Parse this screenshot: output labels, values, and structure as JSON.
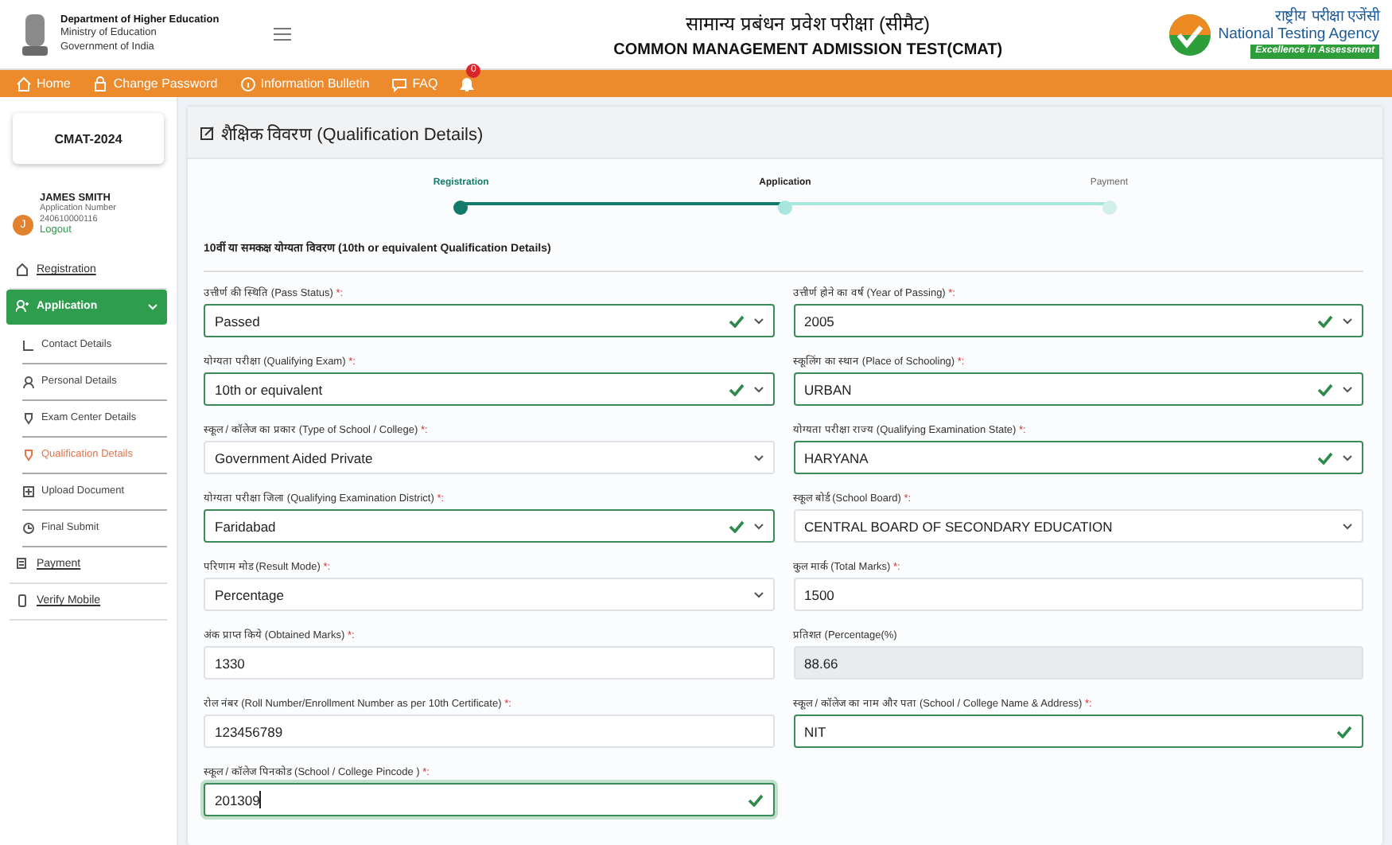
{
  "header": {
    "dept": "Department of Higher Education",
    "ministry": "Ministry of Education",
    "govt": "Government of India",
    "title_hi": "सामान्य प्रबंधन प्रवेश परीक्षा (सीमैट)",
    "title_en": "COMMON MANAGEMENT ADMISSION TEST(CMAT)",
    "agency_hi": "राष्ट्रीय परीक्षा एजेंसी",
    "agency_en": "National Testing Agency",
    "tagline": "Excellence in Assessment"
  },
  "nav": [
    {
      "label": "Home"
    },
    {
      "label": "Change Password"
    },
    {
      "label": "Information Bulletin"
    },
    {
      "label": "FAQ"
    }
  ],
  "notifications": {
    "count": "0"
  },
  "sidebar": {
    "exam": "CMAT-2024",
    "user": {
      "initial": "J",
      "name": "JAMES SMITH",
      "number_label": "Application Number",
      "number": "240610000116",
      "logout": "Logout"
    },
    "items": [
      {
        "label": "Registration",
        "selected": false
      },
      {
        "label": "Application",
        "selected": true,
        "expanded": true,
        "children": [
          {
            "label": "Contact Details",
            "selected": false
          },
          {
            "label": "Personal Details",
            "selected": false
          },
          {
            "label": "Exam Center Details",
            "selected": false
          },
          {
            "label": "Qualification Details",
            "selected": true
          },
          {
            "label": "Upload Document",
            "selected": false
          },
          {
            "label": "Final Submit",
            "selected": false
          }
        ]
      },
      {
        "label": "Payment",
        "selected": false
      },
      {
        "label": "Verify Mobile",
        "selected": false
      }
    ]
  },
  "page": {
    "title": "शैक्षिक विवरण (Qualification Details)"
  },
  "steps": [
    {
      "label": "Registration",
      "completed": true,
      "current": false
    },
    {
      "label": "Application",
      "completed": false,
      "current": true
    },
    {
      "label": "Payment",
      "completed": false,
      "current": false
    }
  ],
  "section": "10वीं या समकक्ष योग्यता विवरण (10th or equivalent Qualification Details)",
  "fields": [
    {
      "label": "उत्तीर्ण की स्थिति (Pass Status)",
      "mark": "*:",
      "value": "Passed",
      "kind": "select",
      "valid": true
    },
    {
      "label": "उत्तीर्ण होने का वर्ष (Year of Passing)",
      "mark": "*:",
      "value": "2005",
      "kind": "select",
      "valid": true
    },
    {
      "label": "योग्यता परीक्षा (Qualifying Exam)",
      "mark": "*:",
      "value": "10th or equivalent",
      "kind": "select",
      "valid": true
    },
    {
      "label": "स्कूलिंग का स्थान (Place of Schooling)",
      "mark": "*:",
      "value": "URBAN",
      "kind": "select",
      "valid": true
    },
    {
      "label": "स्कूल / कॉलेज का प्रकार (Type of School / College)",
      "mark": "*:",
      "value": "Government Aided Private",
      "kind": "select",
      "valid": false
    },
    {
      "label": "योग्यता परीक्षा राज्य (Qualifying Examination State)",
      "mark": "*:",
      "value": "HARYANA",
      "kind": "select",
      "valid": true
    },
    {
      "label": "योग्यता परीक्षा जिला (Qualifying Examination District)",
      "mark": "*:",
      "value": "Faridabad",
      "kind": "select",
      "valid": true
    },
    {
      "label": "स्कूल बोर्ड (School Board)",
      "mark": "*:",
      "value": "CENTRAL BOARD OF SECONDARY EDUCATION",
      "kind": "select",
      "valid": false
    },
    {
      "label": "परिणाम मोड (Result Mode)",
      "mark": "*:",
      "value": "Percentage",
      "kind": "select",
      "valid": false
    },
    {
      "label": "कुल मार्क (Total Marks)",
      "mark": "*:",
      "value": "1500",
      "kind": "text",
      "valid": false
    },
    {
      "label": "अंक प्राप्त किये (Obtained Marks)",
      "mark": "*:",
      "value": "1330",
      "kind": "text",
      "valid": false
    },
    {
      "label": "प्रतिशत (Percentage(%)",
      "value": "88.66",
      "kind": "text",
      "valid": false,
      "disabled": true
    },
    {
      "label": "रोल नंबर (Roll Number/Enrollment Number as per 10th Certificate)",
      "mark": "*:",
      "value": "123456789",
      "kind": "text",
      "valid": false
    },
    {
      "label": "स्कूल / कॉलेज का नाम और पता (School / College Name & Address)",
      "mark": "*:",
      "value": "NIT",
      "kind": "text",
      "valid": true
    },
    {
      "label": "स्कूल / कॉलेज पिनकोड (School / College Pincode )",
      "mark": "*:",
      "value": "201309",
      "kind": "text",
      "valid": true,
      "focused": true
    }
  ]
}
